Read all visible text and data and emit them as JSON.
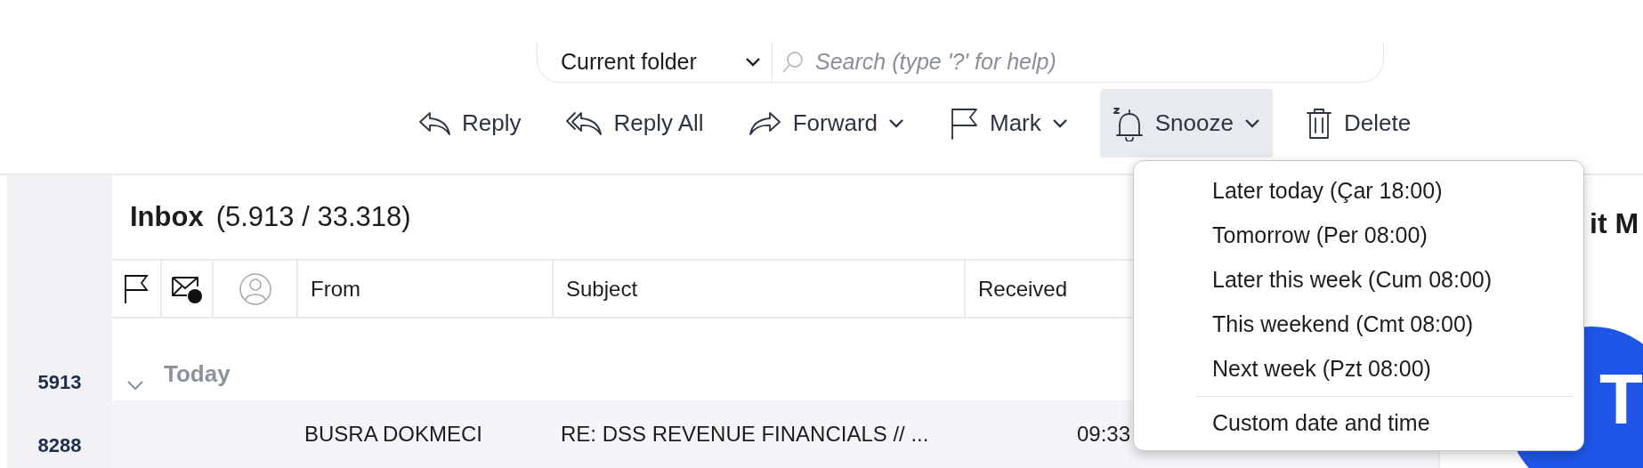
{
  "search": {
    "scope": "Current folder",
    "placeholder": "Search (type '?' for help)"
  },
  "toolbar": [
    {
      "kind": "reply",
      "label": "Reply",
      "dropdown": false,
      "expanded": false
    },
    {
      "kind": "reply-all",
      "label": "Reply All",
      "dropdown": false,
      "expanded": false
    },
    {
      "kind": "forward",
      "label": "Forward",
      "dropdown": true,
      "expanded": false
    },
    {
      "kind": "mark",
      "label": "Mark",
      "dropdown": true,
      "expanded": false
    },
    {
      "kind": "snooze",
      "label": "Snooze",
      "dropdown": true,
      "expanded": true
    },
    {
      "kind": "delete",
      "label": "Delete",
      "dropdown": false,
      "expanded": false
    }
  ],
  "snooze_menu": {
    "options": [
      "Later today (Çar 18:00)",
      "Tomorrow (Per 08:00)",
      "Later this week (Cum 08:00)",
      "This weekend (Cmt 08:00)",
      "Next week (Pzt 08:00)"
    ],
    "custom": "Custom date and time"
  },
  "folder_counts": [
    "5913",
    "8288"
  ],
  "inbox": {
    "title": "Inbox",
    "counts": "(5.913 / 33.318)"
  },
  "columns": [
    {
      "kind": "flag"
    },
    {
      "kind": "unread"
    },
    {
      "kind": "contact"
    },
    {
      "kind": "text",
      "label": "From"
    },
    {
      "kind": "text",
      "label": "Subject"
    },
    {
      "kind": "sort",
      "label": "Received"
    }
  ],
  "groups": [
    {
      "label": "Today",
      "expanded": true,
      "rows": [
        {
          "from": "BUSRA DOKMECI",
          "subject": "RE: DSS REVENUE FINANCIALS // ...",
          "received": "09:33"
        }
      ]
    }
  ],
  "reading_pane": {
    "title": "it M",
    "avatar_letter": "T"
  }
}
